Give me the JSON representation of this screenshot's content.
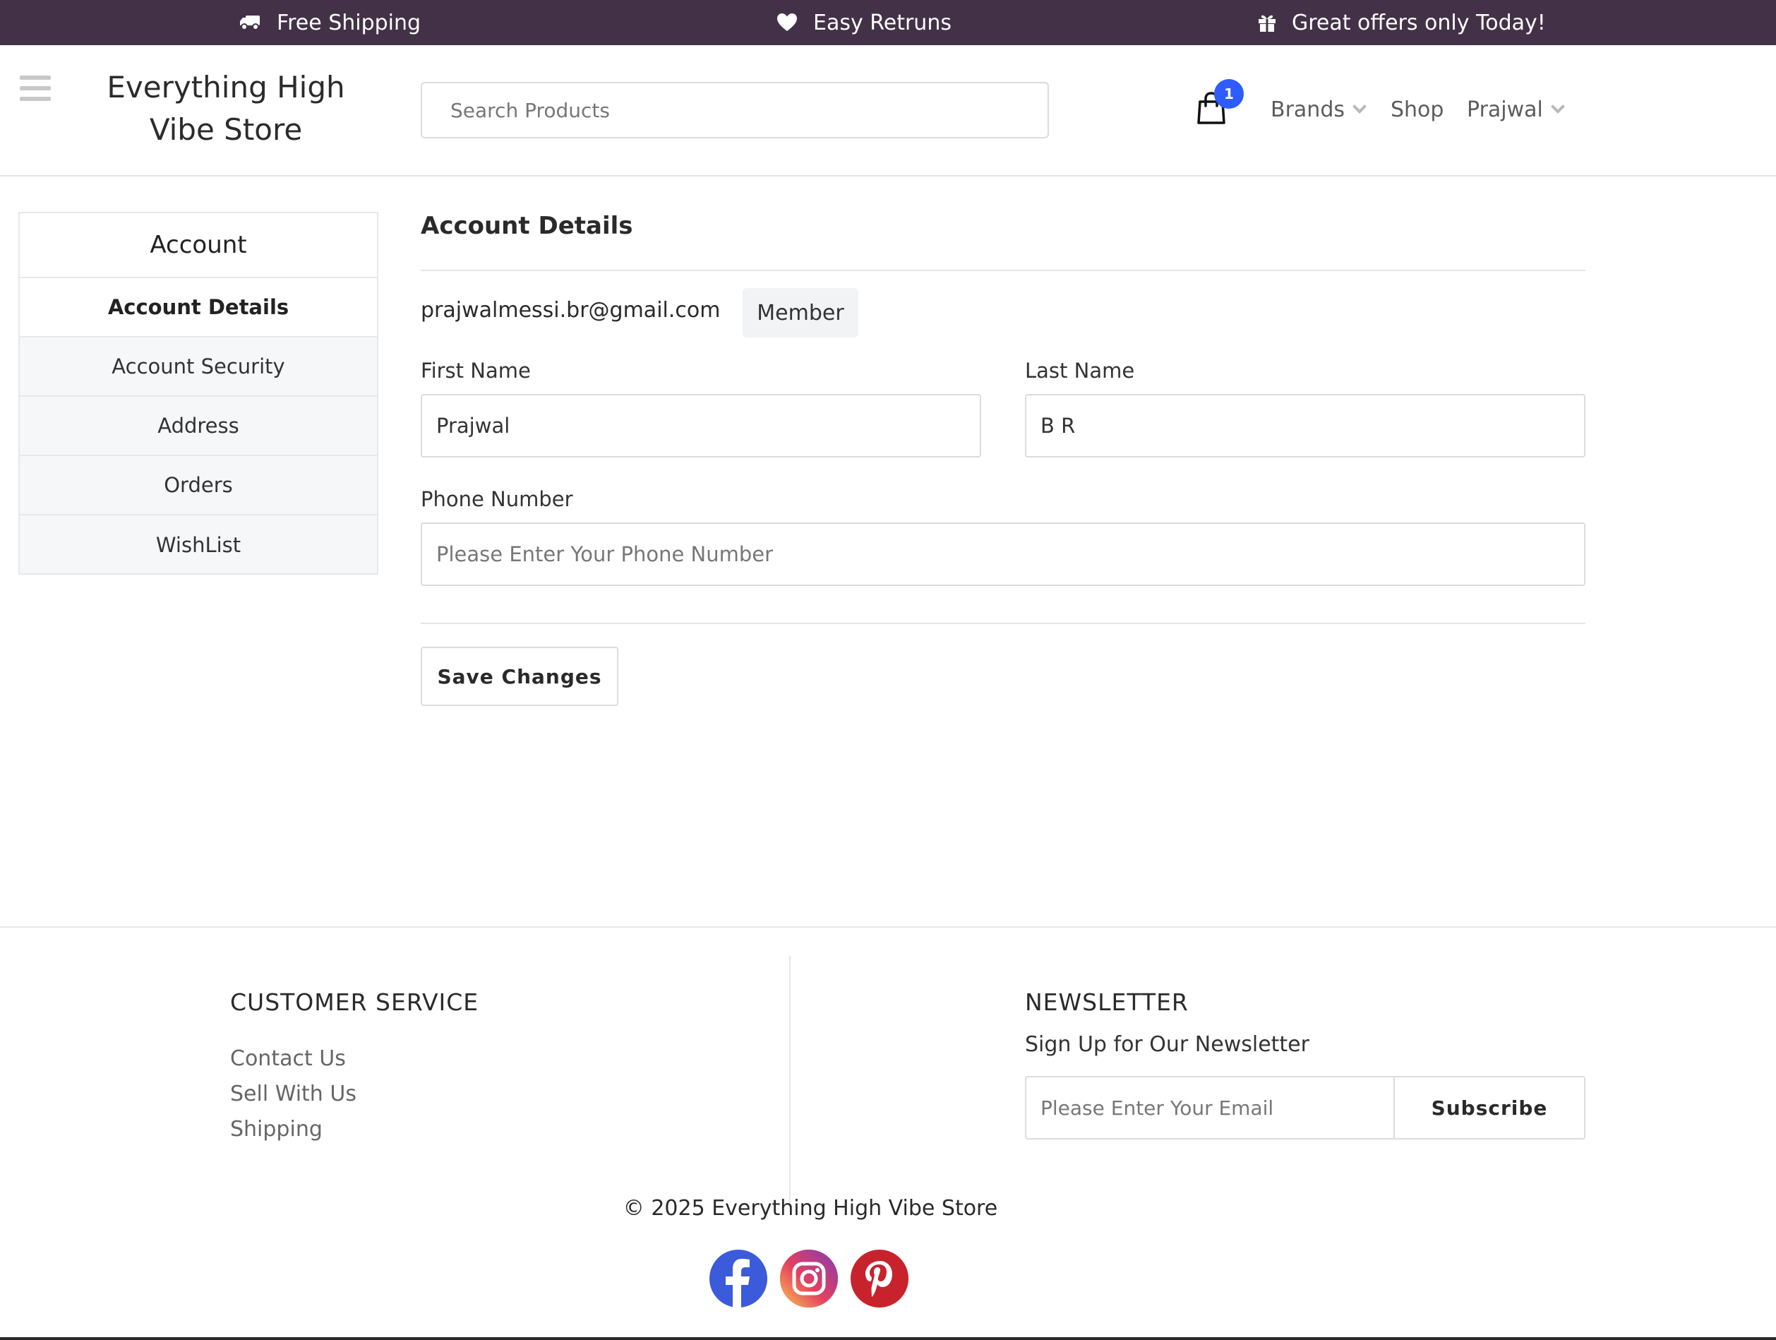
{
  "promo": {
    "shipping": "Free Shipping",
    "returns": "Easy Retruns",
    "offers": "Great offers only Today!"
  },
  "header": {
    "brand": "Everything High Vibe Store",
    "search_placeholder": "Search Products",
    "cart_count": "1",
    "nav": {
      "brands": "Brands",
      "shop": "Shop",
      "user": "Prajwal"
    }
  },
  "sidebar": {
    "title": "Account",
    "items": [
      {
        "label": "Account Details",
        "active": true
      },
      {
        "label": "Account Security"
      },
      {
        "label": "Address"
      },
      {
        "label": "Orders"
      },
      {
        "label": "WishList"
      }
    ]
  },
  "account": {
    "title": "Account Details",
    "email": "prajwalmessi.br@gmail.com",
    "role": "Member",
    "first_name_label": "First Name",
    "first_name_value": "Prajwal",
    "last_name_label": "Last Name",
    "last_name_value": "B R",
    "phone_label": "Phone Number",
    "phone_placeholder": "Please Enter Your Phone Number",
    "save_label": "Save Changes"
  },
  "footer": {
    "customer_service": {
      "heading": "CUSTOMER SERVICE",
      "links": [
        "Contact Us",
        "Sell With Us",
        "Shipping"
      ]
    },
    "newsletter": {
      "heading": "NEWSLETTER",
      "subheading": "Sign Up for Our Newsletter",
      "email_placeholder": "Please Enter Your Email",
      "subscribe_label": "Subscribe"
    },
    "copyright": "© 2025 Everything High Vibe Store",
    "social": [
      "facebook-icon",
      "instagram-icon",
      "pinterest-icon"
    ]
  },
  "colors": {
    "promo_bar": "#433247",
    "cart_badge": "#2f5cff",
    "facebook": "#3b5bdb",
    "instagram": "#e4405f",
    "pinterest": "#c8232c"
  }
}
